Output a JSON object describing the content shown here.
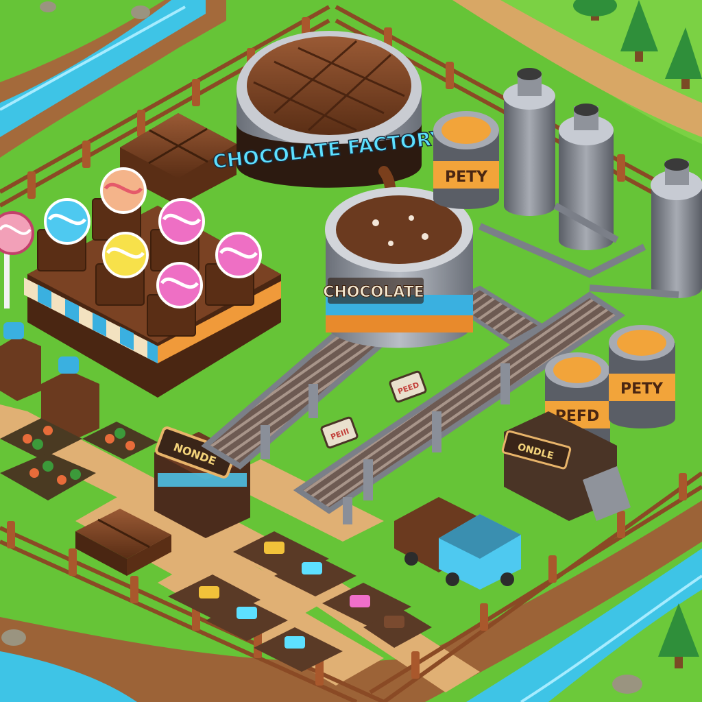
{
  "scene": {
    "main_sign": "CHOCOLATE FACTORY",
    "vat_label": "CHOCOLATE",
    "silo_label": "PETY",
    "silo_label_2": "PETY",
    "silo_label_3": "PEFD",
    "shop_sign": "NONDE",
    "shop_sign_2": "ONDLE",
    "mini_sign_1": "PEED",
    "mini_sign_2": "PEIII"
  },
  "colors": {
    "grass": "#6cc93a",
    "grass_dark": "#4ea62a",
    "path": "#e0b074",
    "river": "#3ec4e6",
    "chocolate": "#6b3a1f",
    "chocolate_light": "#8d5232",
    "metal": "#8f8f95",
    "sign_text": "#5de0ff",
    "orange": "#f2a43a"
  },
  "icons": [
    "tree-icon",
    "candy-icon",
    "lollipop-icon",
    "chocolate-bar-icon",
    "silo-icon",
    "chimney-icon",
    "conveyor-icon",
    "fence-icon"
  ]
}
